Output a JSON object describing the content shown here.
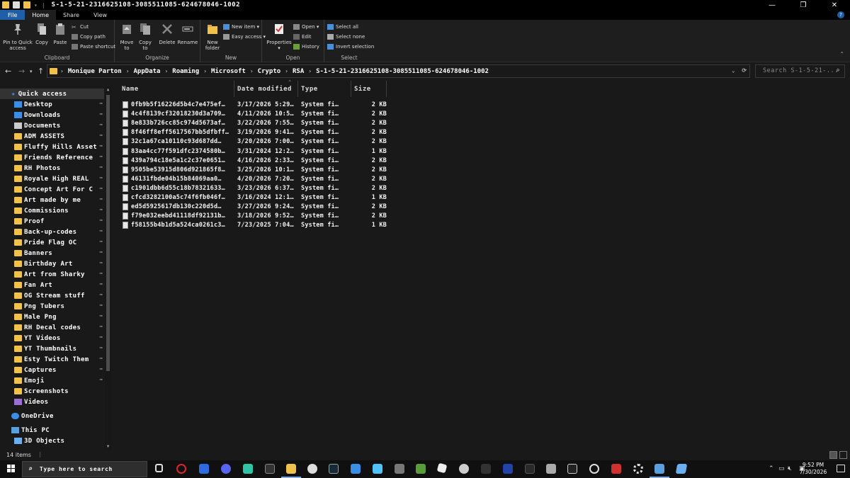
{
  "window": {
    "title": "S-1-5-21-2316625108-3085511085-624678046-1002",
    "controls": {
      "minimize": "—",
      "maximize": "❐",
      "close": "✕"
    }
  },
  "ribbon": {
    "tabs": [
      "File",
      "Home",
      "Share",
      "View"
    ],
    "clipboard": {
      "label": "Clipboard",
      "pin": "Pin to Quick access",
      "copy": "Copy",
      "paste": "Paste",
      "cut": "Cut",
      "copy_path": "Copy path",
      "paste_shortcut": "Paste shortcut"
    },
    "organize": {
      "label": "Organize",
      "move_to": "Move to",
      "copy_to": "Copy to",
      "delete": "Delete",
      "rename": "Rename"
    },
    "new": {
      "label": "New",
      "new_folder": "New folder",
      "new_item": "New item",
      "easy_access": "Easy access"
    },
    "open": {
      "label": "Open",
      "properties": "Properties",
      "open": "Open",
      "edit": "Edit",
      "history": "History"
    },
    "select": {
      "label": "Select",
      "select_all": "Select all",
      "select_none": "Select none",
      "invert": "Invert selection"
    }
  },
  "address": {
    "crumbs": [
      "Monique Parton",
      "AppData",
      "Roaming",
      "Microsoft",
      "Crypto",
      "RSA",
      "S-1-5-21-2316625108-3085511085-624678046-1002"
    ],
    "search_placeholder": "Search S-1-5-21-..."
  },
  "nav_pane": {
    "quick_access": "Quick access",
    "items": [
      {
        "label": "Desktop",
        "icon": "desktop-icon",
        "color": "#3a8ee6"
      },
      {
        "label": "Downloads",
        "icon": "download-icon",
        "color": "#3a8ee6"
      },
      {
        "label": "Documents",
        "icon": "document-icon",
        "color": "#cccccc"
      },
      {
        "label": "ADM ASSETS",
        "icon": "folder-icon",
        "color": "#f0c14b"
      },
      {
        "label": "Fluffy Hills Asset",
        "icon": "folder-icon",
        "color": "#f0c14b"
      },
      {
        "label": "Friends Reference",
        "icon": "folder-icon",
        "color": "#f0c14b"
      },
      {
        "label": "RH Photos",
        "icon": "folder-icon",
        "color": "#f0c14b"
      },
      {
        "label": "Royale High REAL",
        "icon": "folder-icon",
        "color": "#f0c14b"
      },
      {
        "label": "Concept Art For C",
        "icon": "folder-icon",
        "color": "#f0c14b"
      },
      {
        "label": "Art made by me",
        "icon": "folder-icon",
        "color": "#f0c14b"
      },
      {
        "label": "Commissions",
        "icon": "folder-icon",
        "color": "#f0c14b"
      },
      {
        "label": "Proof",
        "icon": "folder-icon",
        "color": "#f0c14b"
      },
      {
        "label": "Back-up-codes",
        "icon": "folder-icon",
        "color": "#f0c14b"
      },
      {
        "label": "Pride Flag OC",
        "icon": "folder-icon",
        "color": "#f0c14b"
      },
      {
        "label": "Banners",
        "icon": "folder-icon",
        "color": "#f0c14b"
      },
      {
        "label": "Birthday Art",
        "icon": "folder-icon",
        "color": "#f0c14b"
      },
      {
        "label": "Art from Sharky",
        "icon": "folder-icon",
        "color": "#f0c14b"
      },
      {
        "label": "Fan Art",
        "icon": "folder-icon",
        "color": "#f0c14b"
      },
      {
        "label": "OG Stream stuff",
        "icon": "folder-icon",
        "color": "#f0c14b"
      },
      {
        "label": "Png Tubers",
        "icon": "folder-icon",
        "color": "#f0c14b"
      },
      {
        "label": "Male Png",
        "icon": "folder-icon",
        "color": "#f0c14b"
      },
      {
        "label": "RH Decal codes",
        "icon": "folder-icon",
        "color": "#f0c14b"
      },
      {
        "label": "YT Videos",
        "icon": "folder-icon",
        "color": "#f0c14b"
      },
      {
        "label": "YT Thumbnails",
        "icon": "folder-icon",
        "color": "#f0c14b"
      },
      {
        "label": "Esty Twitch Them",
        "icon": "folder-icon",
        "color": "#f0c14b"
      },
      {
        "label": "Captures",
        "icon": "folder-icon",
        "color": "#f0c14b"
      },
      {
        "label": "Emoji",
        "icon": "folder-icon",
        "color": "#f0c14b"
      },
      {
        "label": "Screenshots",
        "icon": "folder-icon",
        "color": "#f0c14b"
      },
      {
        "label": "Videos",
        "icon": "video-icon",
        "color": "#9b6fd6"
      }
    ],
    "onedrive": "OneDrive",
    "this_pc": "This PC",
    "objects_3d": "3D Objects"
  },
  "files": {
    "headers": [
      "Name",
      "Date modified",
      "Type",
      "Size"
    ],
    "rows": [
      {
        "name": "0fb9b5f16226d5b4c7e475ef…",
        "date": "3/17/2026 5:29…",
        "type": "System fi…",
        "size": "2 KB"
      },
      {
        "name": "4c4f8139cf32018230d3a709…",
        "date": "4/11/2026 10:5…",
        "type": "System fi…",
        "size": "2 KB"
      },
      {
        "name": "8e833b726cc85c974d5673af…",
        "date": "3/22/2026 7:55…",
        "type": "System fi…",
        "size": "2 KB"
      },
      {
        "name": "8f46ff8eff5617567bb5dfbff…",
        "date": "3/19/2026 9:41…",
        "type": "System fi…",
        "size": "2 KB"
      },
      {
        "name": "32c1a67ca10110c93d687dd…",
        "date": "3/20/2026 7:00…",
        "type": "System fi…",
        "size": "2 KB"
      },
      {
        "name": "83aa4cc77f591dfc2374580b…",
        "date": "3/31/2024 12:2…",
        "type": "System fi…",
        "size": "1 KB"
      },
      {
        "name": "439a794c18e5a1c2c37e0651…",
        "date": "4/16/2026 2:33…",
        "type": "System fi…",
        "size": "2 KB"
      },
      {
        "name": "9505be53915d806d921865f8…",
        "date": "3/25/2026 10:1…",
        "type": "System fi…",
        "size": "2 KB"
      },
      {
        "name": "46131fbde04b15b84069aa0…",
        "date": "4/20/2026 7:20…",
        "type": "System fi…",
        "size": "2 KB"
      },
      {
        "name": "c1901dbb6d55c18b78321633…",
        "date": "3/23/2026 6:37…",
        "type": "System fi…",
        "size": "2 KB"
      },
      {
        "name": "cfcd3282100a5c74f6fb046f…",
        "date": "3/16/2024 12:1…",
        "type": "System fi…",
        "size": "1 KB"
      },
      {
        "name": "ed5d5925617db130c220d5d…",
        "date": "3/27/2026 9:24…",
        "type": "System fi…",
        "size": "2 KB"
      },
      {
        "name": "f79e032eebd41118df92131b…",
        "date": "3/18/2026 9:52…",
        "type": "System fi…",
        "size": "2 KB"
      },
      {
        "name": "f58155b4b1d5a524ca0261c3…",
        "date": "7/23/2025 7:04…",
        "type": "System fi…",
        "size": "1 KB"
      }
    ]
  },
  "status": {
    "item_count": "14 items",
    "divider": "|"
  },
  "taskbar": {
    "search_placeholder": "Type here to search",
    "time": "9:52 PM",
    "date": "7/30/2026"
  }
}
